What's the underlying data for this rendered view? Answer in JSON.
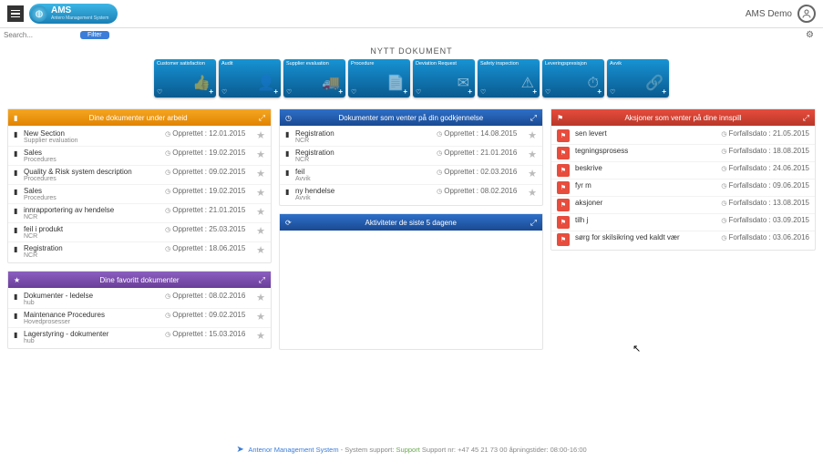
{
  "header": {
    "brand": "AMS",
    "brand_sub": "Antero Management System",
    "user_label": "AMS Demo"
  },
  "search": {
    "placeholder": "Search...",
    "filter_label": "Filter"
  },
  "new_doc_title": "NYTT DOKUMENT",
  "tiles": [
    {
      "label": "Customer satisfaction"
    },
    {
      "label": "Audit"
    },
    {
      "label": "Supplier evaluation"
    },
    {
      "label": "Procedure"
    },
    {
      "label": "Deviation Request"
    },
    {
      "label": "Safety inspection"
    },
    {
      "label": "Leveringspresisjon"
    },
    {
      "label": "Avvik"
    }
  ],
  "panels": {
    "under_work": {
      "title": "Dine dokumenter under arbeid",
      "items": [
        {
          "title": "New Section",
          "sub": "Supplier evaluation",
          "date": "Opprettet : 12.01.2015"
        },
        {
          "title": "Sales",
          "sub": "Procedures",
          "date": "Opprettet : 19.02.2015"
        },
        {
          "title": "Quality & Risk system description",
          "sub": "Procedures",
          "date": "Opprettet : 09.02.2015"
        },
        {
          "title": "Sales",
          "sub": "Procedures",
          "date": "Opprettet : 19.02.2015"
        },
        {
          "title": "innrapportering av hendelse",
          "sub": "NCR",
          "date": "Opprettet : 21.01.2015"
        },
        {
          "title": "feil i produkt",
          "sub": "NCR",
          "date": "Opprettet : 25.03.2015"
        },
        {
          "title": "Registration",
          "sub": "NCR",
          "date": "Opprettet : 18.06.2015"
        }
      ]
    },
    "favorites": {
      "title": "Dine favoritt dokumenter",
      "items": [
        {
          "title": "Dokumenter - ledelse",
          "sub": "hub",
          "date": "Opprettet : 08.02.2016"
        },
        {
          "title": "Maintenance Procedures",
          "sub": "Hovedprosesser",
          "date": "Opprettet : 09.02.2015"
        },
        {
          "title": "Lagerstyring - dokumenter",
          "sub": "hub",
          "date": "Opprettet : 15.03.2016"
        }
      ]
    },
    "approval": {
      "title": "Dokumenter som venter på din godkjennelse",
      "items": [
        {
          "title": "Registration",
          "sub": "NCR",
          "date": "Opprettet : 14.08.2015"
        },
        {
          "title": "Registration",
          "sub": "NCR",
          "date": "Opprettet : 21.01.2016"
        },
        {
          "title": "feil",
          "sub": "Avvik",
          "date": "Opprettet : 02.03.2016"
        },
        {
          "title": "ny hendelse",
          "sub": "Avvik",
          "date": "Opprettet : 08.02.2016"
        }
      ]
    },
    "activities": {
      "title": "Aktiviteter de siste 5 dagene"
    },
    "actions": {
      "title": "Aksjoner som venter på dine innspill",
      "items": [
        {
          "title": "sen levert",
          "date": "Forfallsdato : 21.05.2015"
        },
        {
          "title": "tegningsprosess",
          "date": "Forfallsdato : 18.08.2015"
        },
        {
          "title": "beskrive",
          "date": "Forfallsdato : 24.06.2015"
        },
        {
          "title": "fyr m",
          "date": "Forfallsdato : 09.06.2015"
        },
        {
          "title": "aksjoner",
          "date": "Forfallsdato : 13.08.2015"
        },
        {
          "title": "tilh j",
          "date": "Forfallsdato : 03.09.2015"
        },
        {
          "title": "sørg for skilsikring ved kaldt vær",
          "date": "Forfallsdato : 03.06.2016"
        }
      ]
    }
  },
  "footer": {
    "brand": "Antenor Management System",
    "mid": " - System support: ",
    "support_label": "Support",
    "tail": " Support nr: +47 45 21 73 00 åpningstider: 08:00-16:00"
  }
}
